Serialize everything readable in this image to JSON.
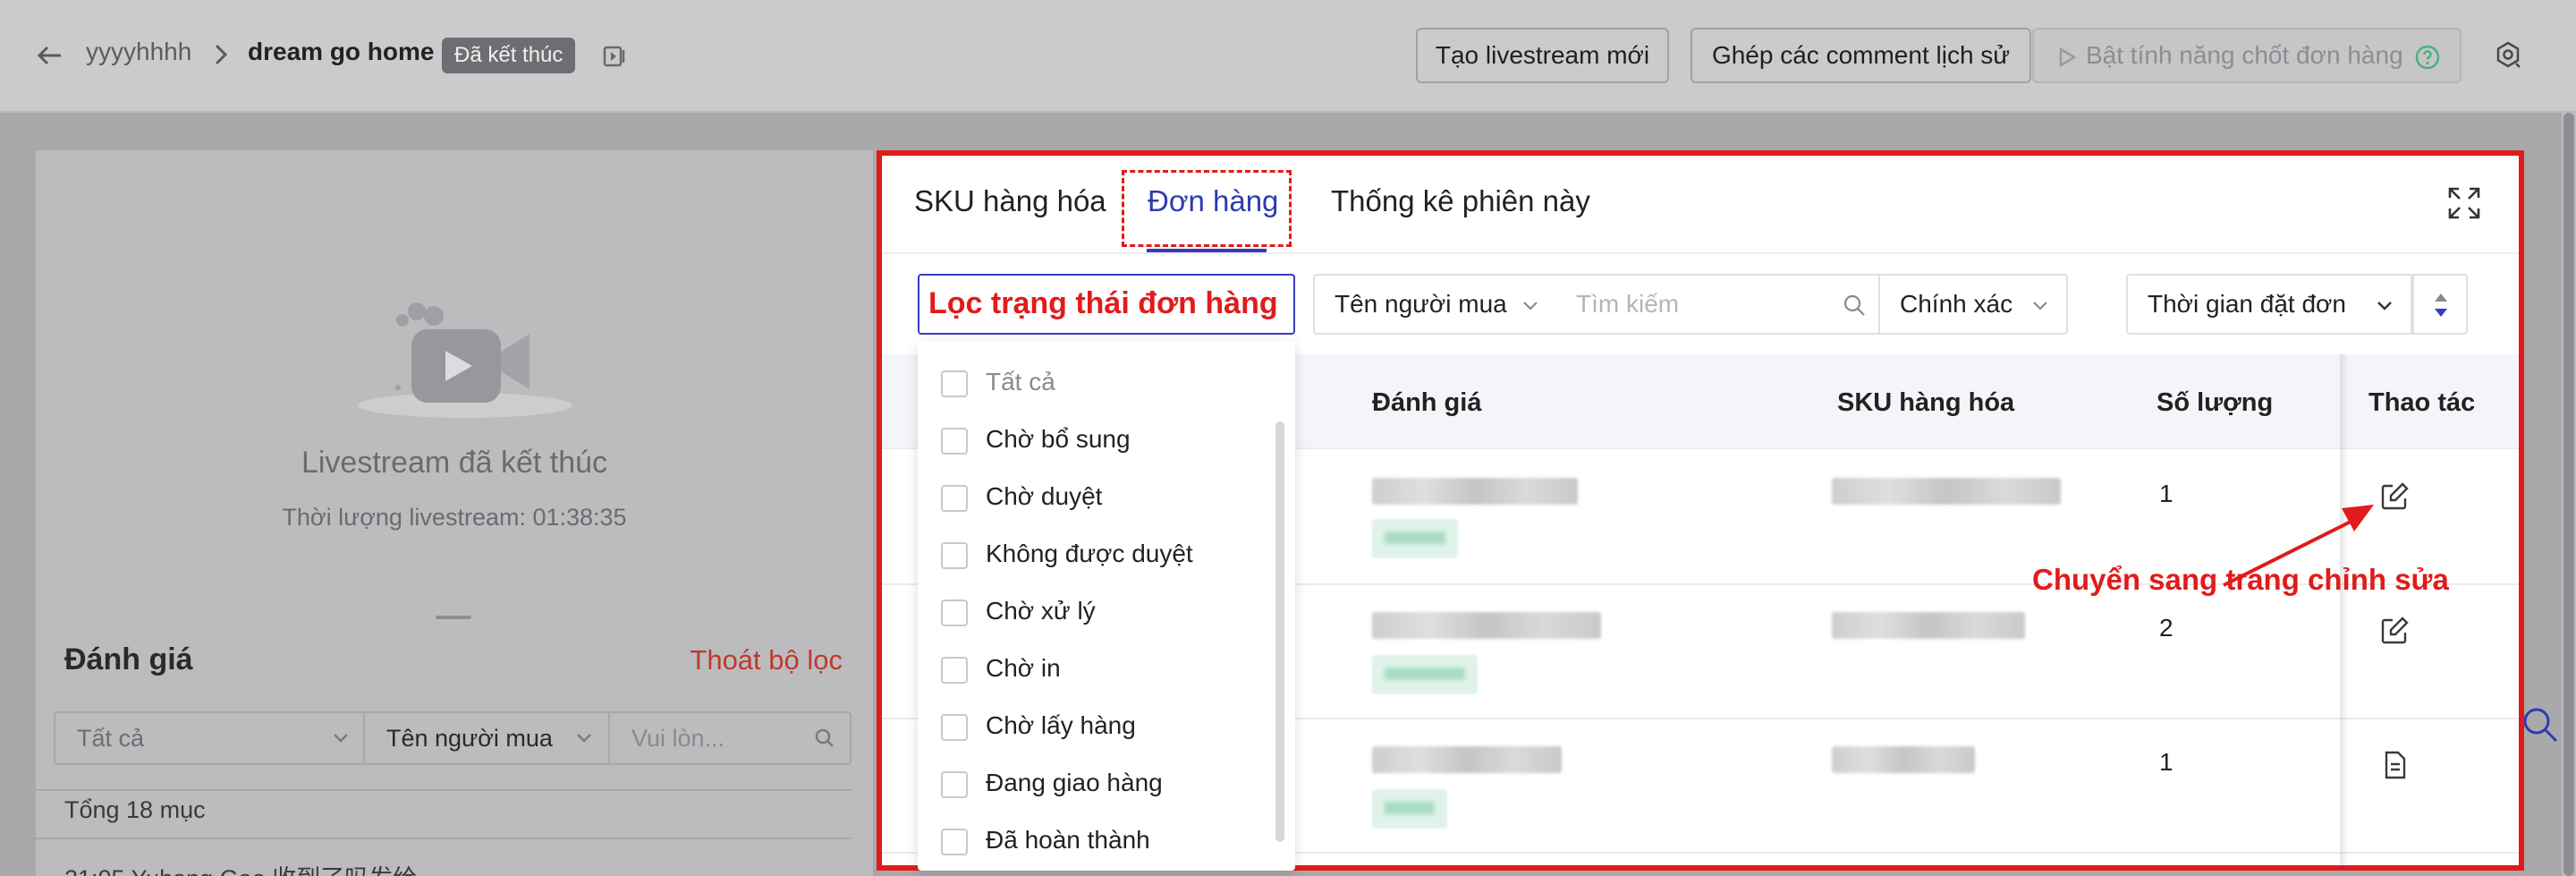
{
  "topbar": {
    "crumb_account": "yyyyhhhh",
    "crumb_session": "dream go home",
    "status_badge": "Đã kết thúc",
    "btn_new_livestream": "Tạo livestream mới",
    "btn_merge_comments": "Ghép các comment lịch sử",
    "btn_enable_close": "Bật tính năng chốt đơn hàng"
  },
  "left_panel": {
    "ended_title": "Livestream đã kết thúc",
    "duration": "Thời lượng livestream: 01:38:35",
    "reviews_title": "Đánh giá",
    "clear_filter": "Thoát bộ lọc",
    "select_all": "Tất cả",
    "select_buyer": "Tên người mua",
    "search_placeholder": "Vui lòn...",
    "total": "Tổng 18 mục",
    "comment_preview": "21:05 Yuhang Gao 收到了吗发给"
  },
  "main": {
    "tabs": [
      {
        "label": "SKU hàng hóa"
      },
      {
        "label": "Đơn hàng"
      },
      {
        "label": "Thống kê phiên này"
      }
    ],
    "active_tab": "Đơn hàng",
    "status_filter_label": "Lọc trạng thái đơn hàng",
    "buyer_select": "Tên người mua",
    "search_placeholder": "Tìm kiếm",
    "exact_select": "Chính xác",
    "time_select": "Thời gian đặt đơn",
    "columns": {
      "review": "Đánh giá",
      "sku": "SKU hàng hóa",
      "qty": "Số lượng",
      "action": "Thao tác"
    },
    "rows": [
      {
        "qty": "1",
        "action_icon": "edit-icon"
      },
      {
        "qty": "2",
        "action_icon": "edit-icon"
      },
      {
        "qty": "1",
        "action_icon": "document-icon"
      }
    ],
    "annotation": "Chuyển sang trang chỉnh sửa"
  },
  "status_dropdown": {
    "options": [
      "Tất cả",
      "Chờ bổ sung",
      "Chờ duyệt",
      "Không được duyệt",
      "Chờ xử lý",
      "Chờ in",
      "Chờ lấy hàng",
      "Đang giao hàng",
      "Đã hoàn thành"
    ]
  },
  "colors": {
    "highlight_red": "#e11b1b",
    "active_tab": "#2d3cae",
    "dim_overlay": "#a9a9ab"
  }
}
